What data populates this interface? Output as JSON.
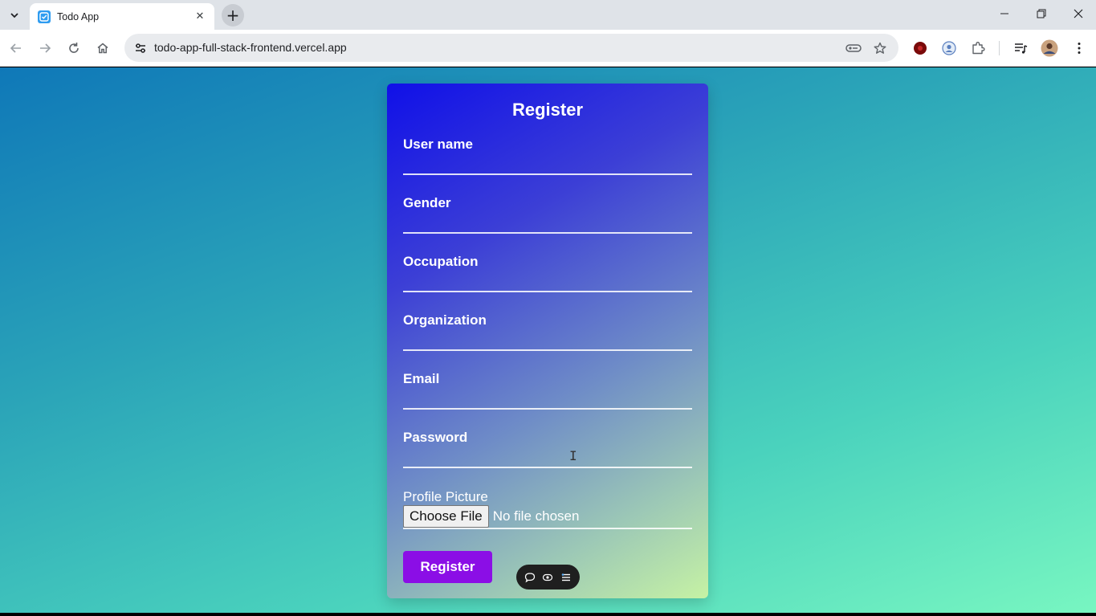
{
  "browser": {
    "tab_title": "Todo App",
    "url": "todo-app-full-stack-frontend.vercel.app"
  },
  "icons": {
    "tab_list": "chevron-down-icon",
    "favicon": "todo-check-icon",
    "tab_close": "close-icon",
    "new_tab": "plus-icon",
    "minimize": "minimize-icon",
    "restore": "restore-icon",
    "close_window": "close-icon",
    "back": "arrow-left-icon",
    "forward": "arrow-right-icon",
    "reload": "reload-icon",
    "home": "home-icon",
    "site_info": "tune-icon",
    "password_key": "key-icon",
    "bookmark": "star-icon",
    "extensions": "puzzle-icon",
    "media": "media-control-icon",
    "menu": "kebab-menu-icon"
  },
  "form": {
    "title": "Register",
    "fields": [
      {
        "label": "User name"
      },
      {
        "label": "Gender"
      },
      {
        "label": "Occupation"
      },
      {
        "label": "Organization"
      },
      {
        "label": "Email"
      },
      {
        "label": "Password"
      }
    ],
    "profile_picture": {
      "label": "Profile Picture",
      "button_label": "Choose File",
      "status": "No file chosen"
    },
    "submit_label": "Register"
  },
  "colors": {
    "submit_button": "#8b0ee6",
    "card_gradient_start": "#1010e8",
    "card_gradient_end": "#c6f2a4",
    "page_gradient_start": "#0f78b8",
    "page_gradient_end": "#78f6c1"
  }
}
